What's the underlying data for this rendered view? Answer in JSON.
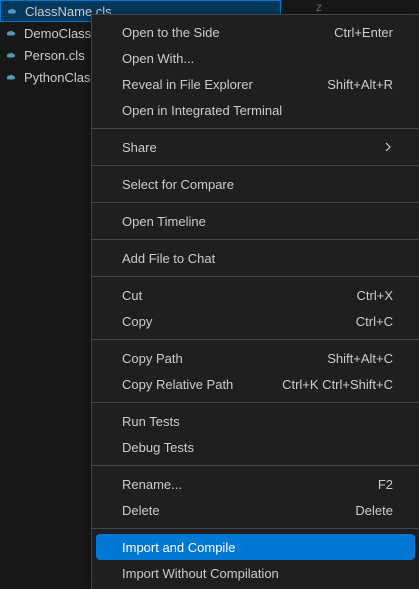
{
  "explorer": {
    "files": [
      {
        "name": "ClassName.cls",
        "selected": true
      },
      {
        "name": "DemoClass.",
        "selected": false
      },
      {
        "name": "Person.cls",
        "selected": false
      },
      {
        "name": "PythonClass",
        "selected": false
      }
    ],
    "icon": "file-cls-icon",
    "icon_color": "#519aba",
    "editor_hint": "z"
  },
  "menu": {
    "groups": [
      [
        {
          "label": "Open to the Side",
          "shortcut": "Ctrl+Enter"
        },
        {
          "label": "Open With...",
          "shortcut": ""
        },
        {
          "label": "Reveal in File Explorer",
          "shortcut": "Shift+Alt+R"
        },
        {
          "label": "Open in Integrated Terminal",
          "shortcut": ""
        }
      ],
      [
        {
          "label": "Share",
          "shortcut": "",
          "submenu": true
        }
      ],
      [
        {
          "label": "Select for Compare",
          "shortcut": ""
        }
      ],
      [
        {
          "label": "Open Timeline",
          "shortcut": ""
        }
      ],
      [
        {
          "label": "Add File to Chat",
          "shortcut": ""
        }
      ],
      [
        {
          "label": "Cut",
          "shortcut": "Ctrl+X"
        },
        {
          "label": "Copy",
          "shortcut": "Ctrl+C"
        }
      ],
      [
        {
          "label": "Copy Path",
          "shortcut": "Shift+Alt+C"
        },
        {
          "label": "Copy Relative Path",
          "shortcut": "Ctrl+K Ctrl+Shift+C"
        }
      ],
      [
        {
          "label": "Run Tests",
          "shortcut": ""
        },
        {
          "label": "Debug Tests",
          "shortcut": ""
        }
      ],
      [
        {
          "label": "Rename...",
          "shortcut": "F2"
        },
        {
          "label": "Delete",
          "shortcut": "Delete"
        }
      ],
      [
        {
          "label": "Import and Compile",
          "shortcut": "",
          "active": true
        },
        {
          "label": "Import Without Compilation",
          "shortcut": ""
        }
      ]
    ]
  },
  "colors": {
    "accent": "#0078d4",
    "menu_bg": "#1f1f1f",
    "separator": "#454545",
    "text": "#cccccc"
  }
}
